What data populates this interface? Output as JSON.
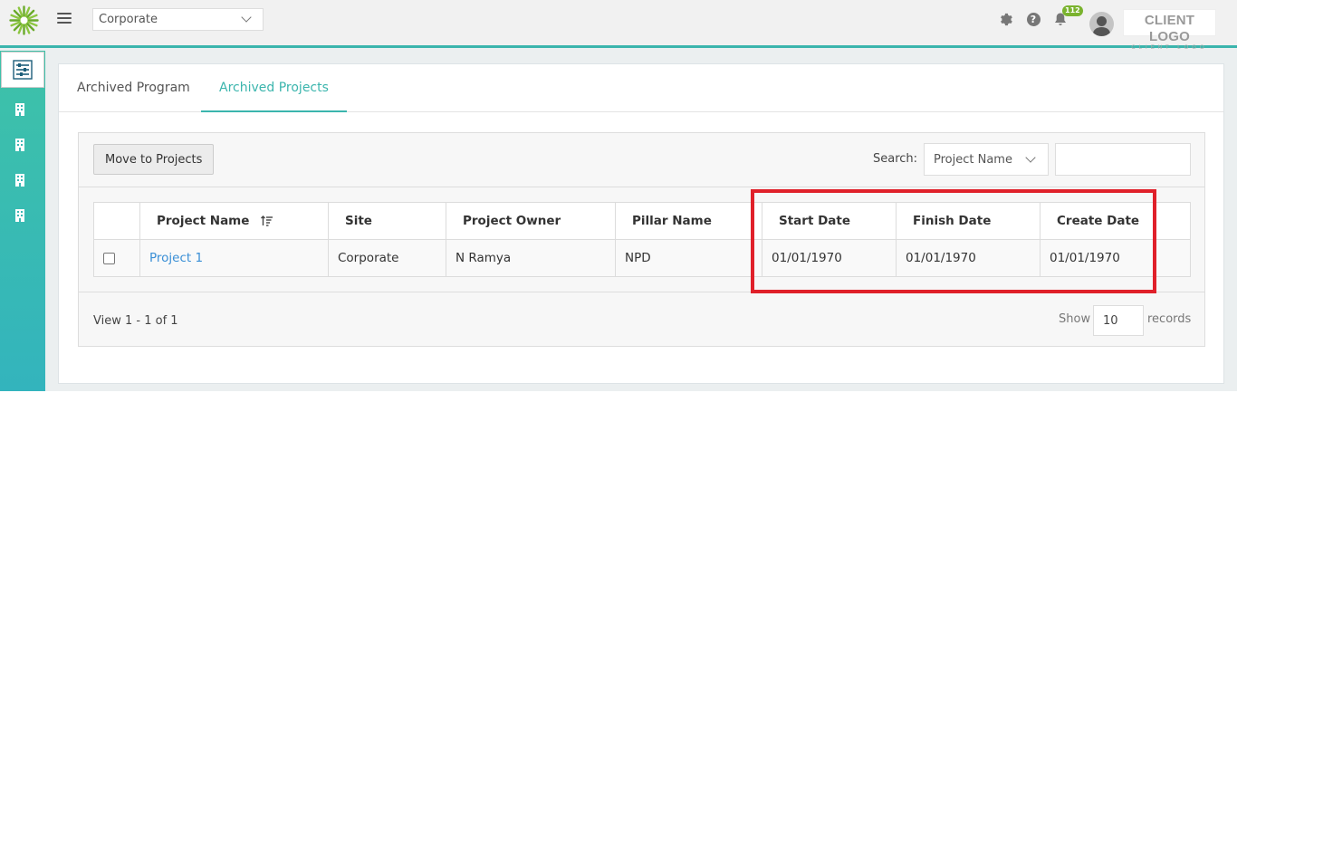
{
  "header": {
    "site_selected": "Corporate",
    "notification_count": "112",
    "client_logo_main": "CLIENT LOGO",
    "client_logo_sub": "CLIENT LOGO"
  },
  "tabs": [
    {
      "label": "Archived Program",
      "active": false
    },
    {
      "label": "Archived Projects",
      "active": true
    }
  ],
  "toolbar": {
    "move_button": "Move to Projects",
    "search_label": "Search:",
    "search_field_selected": "Project Name",
    "search_value": ""
  },
  "table": {
    "columns": [
      "Project Name",
      "Site",
      "Project Owner",
      "Pillar Name",
      "Start Date",
      "Finish Date",
      "Create Date"
    ],
    "rows": [
      {
        "project_name": "Project 1",
        "site": "Corporate",
        "owner": "N Ramya",
        "pillar": "NPD",
        "start_date": "01/01/1970",
        "finish_date": "01/01/1970",
        "create_date": "01/01/1970"
      }
    ]
  },
  "footer": {
    "view_text": "View 1 - 1 of 1",
    "show_label": "Show",
    "rows_per_page": "10",
    "records_label": "records"
  },
  "colors": {
    "accent": "#3bb5ad",
    "highlight": "#e0202a",
    "link": "#3a8fd6",
    "badge": "#7ab32e"
  }
}
